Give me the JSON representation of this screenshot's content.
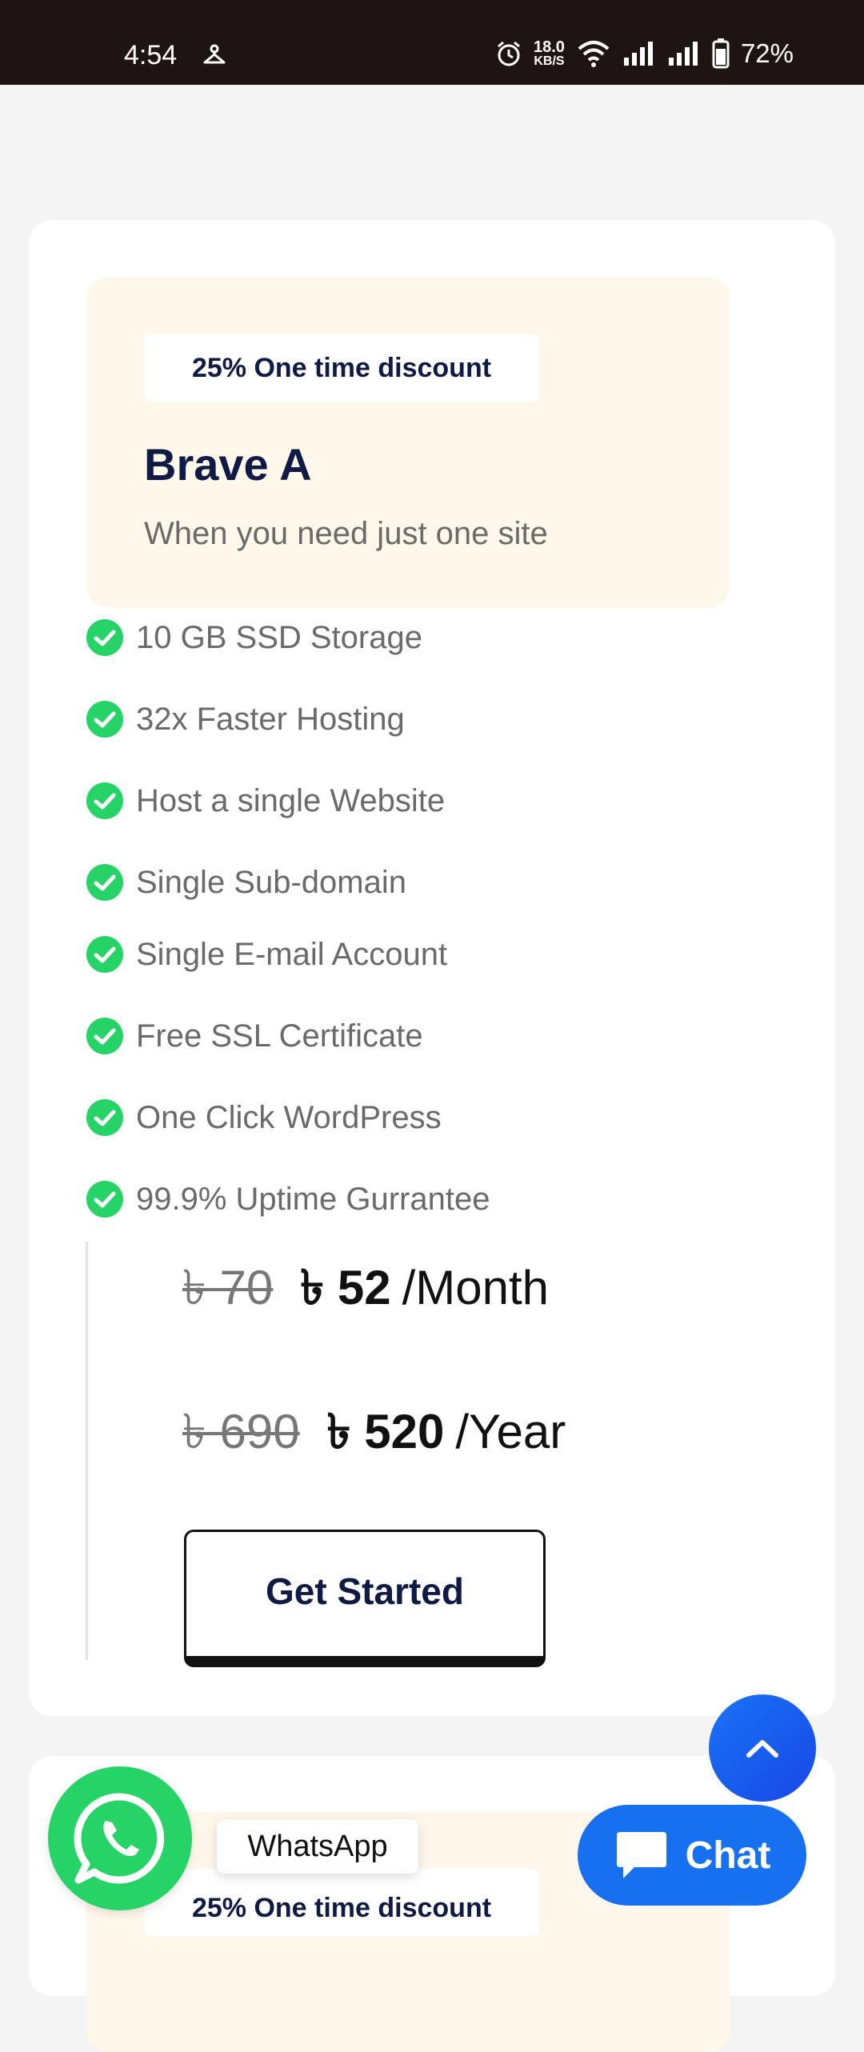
{
  "status_bar": {
    "time": "4:54",
    "net_speed": "18.0",
    "net_unit": "KB/S",
    "battery": "72%"
  },
  "plan": {
    "badge": "25% One time discount",
    "name": "Brave A",
    "description": "When you need just one site",
    "features": [
      "10 GB SSD Storage",
      "32x Faster Hosting",
      "Host a single Website",
      "Single Sub-domain",
      "Single E-mail Account",
      "Free SSL Certificate",
      "One Click WordPress",
      "99.9% Uptime Gurrantee"
    ],
    "monthly": {
      "old": "৳ 70",
      "new": "৳ 52",
      "period": "/Month"
    },
    "yearly": {
      "old": "৳ 690",
      "new": "৳ 520",
      "period": "/Year"
    },
    "cta": "Get Started"
  },
  "next_plan": {
    "badge": "25% One time discount"
  },
  "floating": {
    "whatsapp_label": "WhatsApp",
    "chat_label": "Chat"
  },
  "colors": {
    "accent_green": "#25d366",
    "navy": "#0f1a45",
    "chat_blue": "#1670f0",
    "hero_bg": "#fff8ea"
  }
}
